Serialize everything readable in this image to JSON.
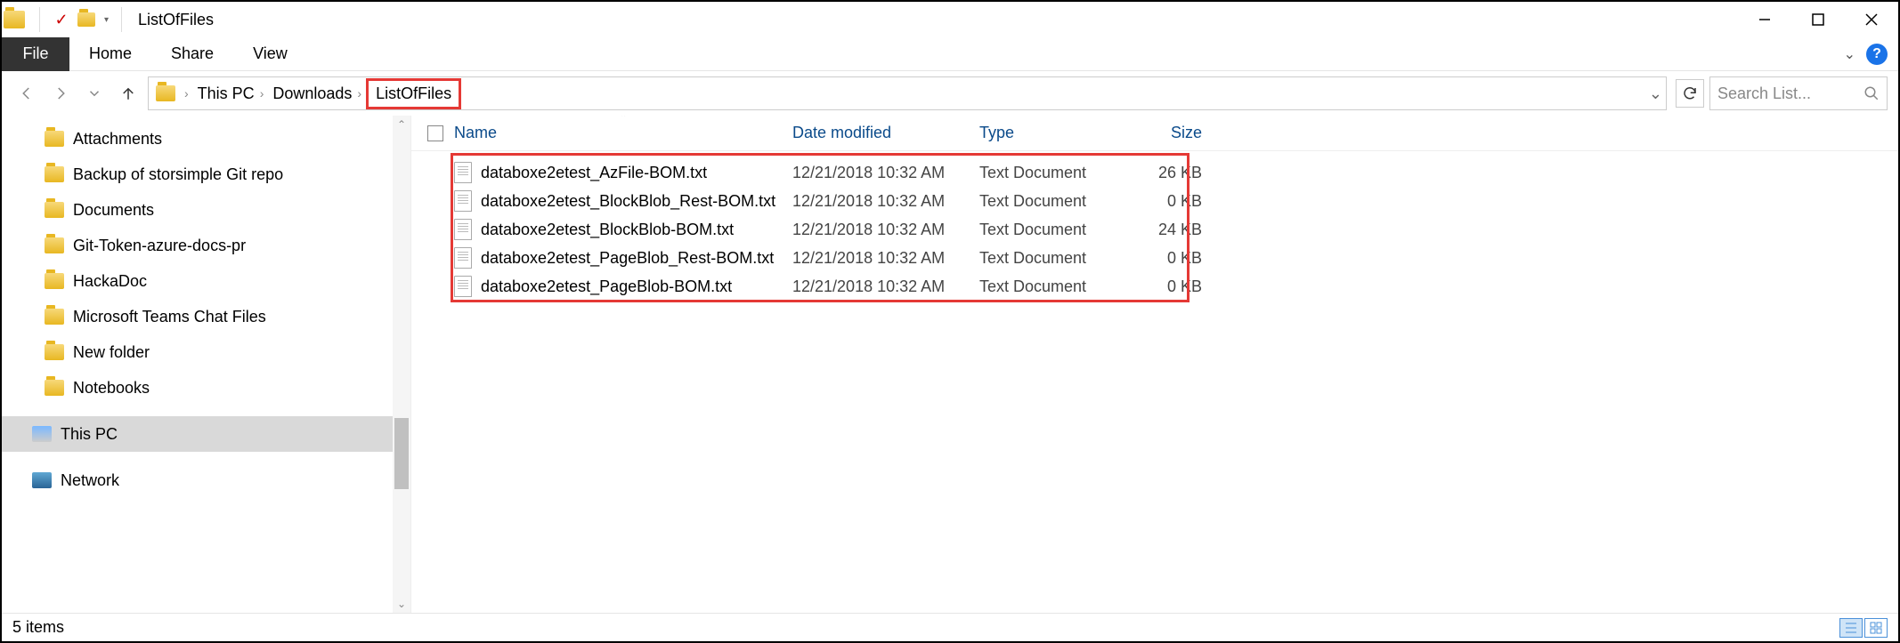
{
  "window": {
    "title": "ListOfFiles",
    "minimize": "Minimize",
    "maximize": "Maximize",
    "close": "Close"
  },
  "ribbon": {
    "file": "File",
    "tabs": [
      "Home",
      "Share",
      "View"
    ]
  },
  "breadcrumbs": [
    "This PC",
    "Downloads",
    "ListOfFiles"
  ],
  "search_placeholder": "Search List...",
  "sidebar": {
    "items": [
      {
        "label": "Attachments"
      },
      {
        "label": "Backup of storsimple Git repo"
      },
      {
        "label": "Documents"
      },
      {
        "label": "Git-Token-azure-docs-pr"
      },
      {
        "label": "HackaDoc"
      },
      {
        "label": "Microsoft Teams Chat Files"
      },
      {
        "label": "New folder"
      },
      {
        "label": "Notebooks"
      }
    ],
    "this_pc": "This PC",
    "network": "Network"
  },
  "columns": {
    "name": "Name",
    "date": "Date modified",
    "type": "Type",
    "size": "Size"
  },
  "files": [
    {
      "name": "databoxe2etest_AzFile-BOM.txt",
      "date": "12/21/2018 10:32 AM",
      "type": "Text Document",
      "size": "26 KB"
    },
    {
      "name": "databoxe2etest_BlockBlob_Rest-BOM.txt",
      "date": "12/21/2018 10:32 AM",
      "type": "Text Document",
      "size": "0 KB"
    },
    {
      "name": "databoxe2etest_BlockBlob-BOM.txt",
      "date": "12/21/2018 10:32 AM",
      "type": "Text Document",
      "size": "24 KB"
    },
    {
      "name": "databoxe2etest_PageBlob_Rest-BOM.txt",
      "date": "12/21/2018 10:32 AM",
      "type": "Text Document",
      "size": "0 KB"
    },
    {
      "name": "databoxe2etest_PageBlob-BOM.txt",
      "date": "12/21/2018 10:32 AM",
      "type": "Text Document",
      "size": "0 KB"
    }
  ],
  "status": "5 items"
}
